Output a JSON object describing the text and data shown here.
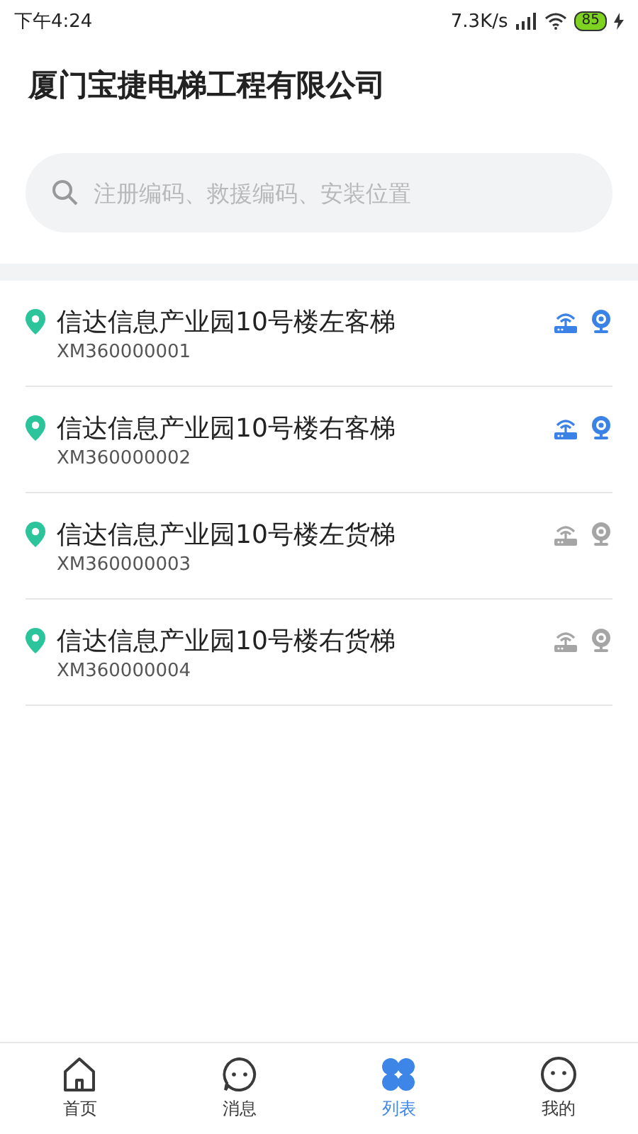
{
  "status_bar": {
    "time": "下午4:24",
    "speed": "7.3K/s",
    "battery": "85"
  },
  "title": "厦门宝捷电梯工程有限公司",
  "search": {
    "placeholder": "注册编码、救援编码、安装位置"
  },
  "elevators": [
    {
      "name": "信达信息产业园10号楼左客梯",
      "code": "XM360000001",
      "online": true
    },
    {
      "name": "信达信息产业园10号楼右客梯",
      "code": "XM360000002",
      "online": true
    },
    {
      "name": "信达信息产业园10号楼左货梯",
      "code": "XM360000003",
      "online": false
    },
    {
      "name": "信达信息产业园10号楼右货梯",
      "code": "XM360000004",
      "online": false
    }
  ],
  "tabs": [
    {
      "label": "首页",
      "kind": "home",
      "selected": false
    },
    {
      "label": "消息",
      "kind": "message",
      "selected": false
    },
    {
      "label": "列表",
      "kind": "list",
      "selected": true
    },
    {
      "label": "我的",
      "kind": "profile",
      "selected": false
    }
  ]
}
